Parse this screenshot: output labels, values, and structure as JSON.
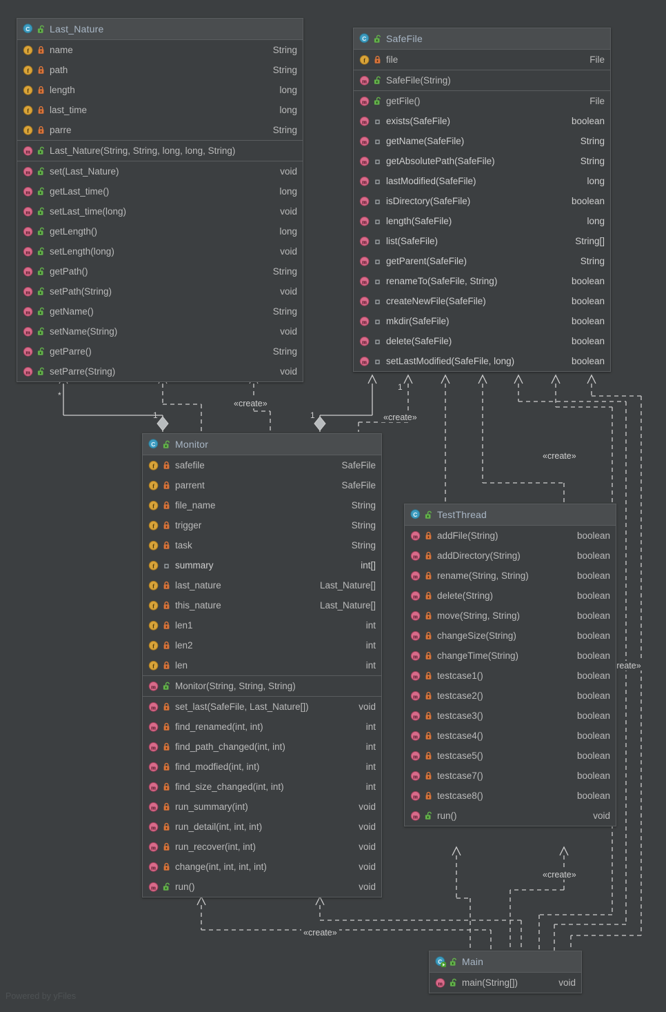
{
  "watermark": "Powered by yFiles",
  "diagram": {
    "kind": "uml-class-diagram",
    "background": "#3c3f41",
    "node_header_bg": "#4a4d4f",
    "border": "#5a5d5f",
    "text": "#bbbbbb",
    "edge": "#cfcfcf"
  },
  "classes": [
    {
      "id": "last_nature",
      "name": "Last_Nature",
      "icon": "class-icon",
      "visibility": "public",
      "fields": [
        {
          "name": "name",
          "type": "String",
          "icon": "field-icon",
          "visibility": "private",
          "static": false
        },
        {
          "name": "path",
          "type": "String",
          "icon": "field-icon",
          "visibility": "private",
          "static": false
        },
        {
          "name": "length",
          "type": "long",
          "icon": "field-icon",
          "visibility": "private",
          "static": false
        },
        {
          "name": "last_time",
          "type": "long",
          "icon": "field-icon",
          "visibility": "private",
          "static": false
        },
        {
          "name": "parre",
          "type": "String",
          "icon": "field-icon",
          "visibility": "private",
          "static": false
        }
      ],
      "constructors": [
        {
          "name": "Last_Nature(String, String, long, long, String)",
          "type": "",
          "icon": "method-icon",
          "visibility": "public",
          "static": false
        }
      ],
      "methods": [
        {
          "name": "set(Last_Nature)",
          "type": "void",
          "icon": "method-icon",
          "visibility": "public",
          "static": false
        },
        {
          "name": "getLast_time()",
          "type": "long",
          "icon": "method-icon",
          "visibility": "public",
          "static": false
        },
        {
          "name": "setLast_time(long)",
          "type": "void",
          "icon": "method-icon",
          "visibility": "public",
          "static": false
        },
        {
          "name": "getLength()",
          "type": "long",
          "icon": "method-icon",
          "visibility": "public",
          "static": false
        },
        {
          "name": "setLength(long)",
          "type": "void",
          "icon": "method-icon",
          "visibility": "public",
          "static": false
        },
        {
          "name": "getPath()",
          "type": "String",
          "icon": "method-icon",
          "visibility": "public",
          "static": false
        },
        {
          "name": "setPath(String)",
          "type": "void",
          "icon": "method-icon",
          "visibility": "public",
          "static": false
        },
        {
          "name": "getName()",
          "type": "String",
          "icon": "method-icon",
          "visibility": "public",
          "static": false
        },
        {
          "name": "setName(String)",
          "type": "void",
          "icon": "method-icon",
          "visibility": "public",
          "static": false
        },
        {
          "name": "getParre()",
          "type": "String",
          "icon": "method-icon",
          "visibility": "public",
          "static": false
        },
        {
          "name": "setParre(String)",
          "type": "void",
          "icon": "method-icon",
          "visibility": "public",
          "static": false
        }
      ]
    },
    {
      "id": "safefile",
      "name": "SafeFile",
      "icon": "class-icon",
      "visibility": "public",
      "fields": [
        {
          "name": "file",
          "type": "File",
          "icon": "field-icon",
          "visibility": "private",
          "static": false
        }
      ],
      "constructors": [
        {
          "name": "SafeFile(String)",
          "type": "",
          "icon": "method-icon",
          "visibility": "public",
          "static": false
        }
      ],
      "methods": [
        {
          "name": "getFile()",
          "type": "File",
          "icon": "method-icon",
          "visibility": "public",
          "static": false
        },
        {
          "name": "exists(SafeFile)",
          "type": "boolean",
          "icon": "method-icon",
          "visibility": "package",
          "static": true
        },
        {
          "name": "getName(SafeFile)",
          "type": "String",
          "icon": "method-icon",
          "visibility": "package",
          "static": true
        },
        {
          "name": "getAbsolutePath(SafeFile)",
          "type": "String",
          "icon": "method-icon",
          "visibility": "package",
          "static": true
        },
        {
          "name": "lastModified(SafeFile)",
          "type": "long",
          "icon": "method-icon",
          "visibility": "package",
          "static": true
        },
        {
          "name": "isDirectory(SafeFile)",
          "type": "boolean",
          "icon": "method-icon",
          "visibility": "package",
          "static": true
        },
        {
          "name": "length(SafeFile)",
          "type": "long",
          "icon": "method-icon",
          "visibility": "package",
          "static": true
        },
        {
          "name": "list(SafeFile)",
          "type": "String[]",
          "icon": "method-icon",
          "visibility": "package",
          "static": true
        },
        {
          "name": "getParent(SafeFile)",
          "type": "String",
          "icon": "method-icon",
          "visibility": "package",
          "static": true
        },
        {
          "name": "renameTo(SafeFile, String)",
          "type": "boolean",
          "icon": "method-icon",
          "visibility": "package",
          "static": true
        },
        {
          "name": "createNewFile(SafeFile)",
          "type": "boolean",
          "icon": "method-icon",
          "visibility": "package",
          "static": true
        },
        {
          "name": "mkdir(SafeFile)",
          "type": "boolean",
          "icon": "method-icon",
          "visibility": "package",
          "static": true
        },
        {
          "name": "delete(SafeFile)",
          "type": "boolean",
          "icon": "method-icon",
          "visibility": "package",
          "static": true
        },
        {
          "name": "setLastModified(SafeFile, long)",
          "type": "boolean",
          "icon": "method-icon",
          "visibility": "package",
          "static": true
        }
      ]
    },
    {
      "id": "monitor",
      "name": "Monitor",
      "icon": "class-icon",
      "visibility": "public",
      "fields": [
        {
          "name": "safefile",
          "type": "SafeFile",
          "icon": "field-icon",
          "visibility": "private",
          "static": false
        },
        {
          "name": "parrent",
          "type": "SafeFile",
          "icon": "field-icon",
          "visibility": "private",
          "static": false
        },
        {
          "name": "file_name",
          "type": "String",
          "icon": "field-icon",
          "visibility": "private",
          "static": false
        },
        {
          "name": "trigger",
          "type": "String",
          "icon": "field-icon",
          "visibility": "private",
          "static": false
        },
        {
          "name": "task",
          "type": "String",
          "icon": "field-icon",
          "visibility": "private",
          "static": false
        },
        {
          "name": "summary",
          "type": "int[]",
          "icon": "field-icon",
          "visibility": "package",
          "static": true
        },
        {
          "name": "last_nature",
          "type": "Last_Nature[]",
          "icon": "field-icon",
          "visibility": "private",
          "static": false
        },
        {
          "name": "this_nature",
          "type": "Last_Nature[]",
          "icon": "field-icon",
          "visibility": "private",
          "static": false
        },
        {
          "name": "len1",
          "type": "int",
          "icon": "field-icon",
          "visibility": "private",
          "static": false
        },
        {
          "name": "len2",
          "type": "int",
          "icon": "field-icon",
          "visibility": "private",
          "static": false
        },
        {
          "name": "len",
          "type": "int",
          "icon": "field-icon",
          "visibility": "private",
          "static": false
        }
      ],
      "constructors": [
        {
          "name": "Monitor(String, String, String)",
          "type": "",
          "icon": "method-icon",
          "visibility": "public",
          "static": false
        }
      ],
      "methods": [
        {
          "name": "set_last(SafeFile, Last_Nature[])",
          "type": "void",
          "icon": "method-icon",
          "visibility": "private",
          "static": false
        },
        {
          "name": "find_renamed(int, int)",
          "type": "int",
          "icon": "method-icon",
          "visibility": "private",
          "static": false
        },
        {
          "name": "find_path_changed(int, int)",
          "type": "int",
          "icon": "method-icon",
          "visibility": "private",
          "static": false
        },
        {
          "name": "find_modfied(int, int)",
          "type": "int",
          "icon": "method-icon",
          "visibility": "private",
          "static": false
        },
        {
          "name": "find_size_changed(int, int)",
          "type": "int",
          "icon": "method-icon",
          "visibility": "private",
          "static": false
        },
        {
          "name": "run_summary(int)",
          "type": "void",
          "icon": "method-icon",
          "visibility": "private",
          "static": false
        },
        {
          "name": "run_detail(int, int, int)",
          "type": "void",
          "icon": "method-icon",
          "visibility": "private",
          "static": false
        },
        {
          "name": "run_recover(int, int)",
          "type": "void",
          "icon": "method-icon",
          "visibility": "private",
          "static": false
        },
        {
          "name": "change(int, int, int, int)",
          "type": "void",
          "icon": "method-icon",
          "visibility": "private",
          "static": false
        },
        {
          "name": "run()",
          "type": "void",
          "icon": "method-icon",
          "visibility": "public",
          "static": false
        }
      ]
    },
    {
      "id": "testthread",
      "name": "TestThread",
      "icon": "class-icon",
      "visibility": "public",
      "fields": [],
      "constructors": [],
      "methods": [
        {
          "name": "addFile(String)",
          "type": "boolean",
          "icon": "method-icon",
          "visibility": "private",
          "static": false
        },
        {
          "name": "addDirectory(String)",
          "type": "boolean",
          "icon": "method-icon",
          "visibility": "private",
          "static": false
        },
        {
          "name": "rename(String, String)",
          "type": "boolean",
          "icon": "method-icon",
          "visibility": "private",
          "static": false
        },
        {
          "name": "delete(String)",
          "type": "boolean",
          "icon": "method-icon",
          "visibility": "private",
          "static": false
        },
        {
          "name": "move(String, String)",
          "type": "boolean",
          "icon": "method-icon",
          "visibility": "private",
          "static": false
        },
        {
          "name": "changeSize(String)",
          "type": "boolean",
          "icon": "method-icon",
          "visibility": "private",
          "static": false
        },
        {
          "name": "changeTime(String)",
          "type": "boolean",
          "icon": "method-icon",
          "visibility": "private",
          "static": false
        },
        {
          "name": "testcase1()",
          "type": "boolean",
          "icon": "method-icon",
          "visibility": "private",
          "static": false
        },
        {
          "name": "testcase2()",
          "type": "boolean",
          "icon": "method-icon",
          "visibility": "private",
          "static": false
        },
        {
          "name": "testcase3()",
          "type": "boolean",
          "icon": "method-icon",
          "visibility": "private",
          "static": false
        },
        {
          "name": "testcase4()",
          "type": "boolean",
          "icon": "method-icon",
          "visibility": "private",
          "static": false
        },
        {
          "name": "testcase5()",
          "type": "boolean",
          "icon": "method-icon",
          "visibility": "private",
          "static": false
        },
        {
          "name": "testcase7()",
          "type": "boolean",
          "icon": "method-icon",
          "visibility": "private",
          "static": false
        },
        {
          "name": "testcase8()",
          "type": "boolean",
          "icon": "method-icon",
          "visibility": "private",
          "static": false
        },
        {
          "name": "run()",
          "type": "void",
          "icon": "method-icon",
          "visibility": "public",
          "static": false
        }
      ]
    },
    {
      "id": "main",
      "name": "Main",
      "icon": "runnable-class-icon",
      "visibility": "public",
      "fields": [],
      "constructors": [],
      "methods": [
        {
          "name": "main(String[])",
          "type": "void",
          "icon": "method-icon",
          "visibility": "public",
          "static": false
        }
      ]
    }
  ],
  "edge_labels": [
    {
      "id": "create-1",
      "text": "«create»"
    },
    {
      "id": "create-2",
      "text": "«create»"
    },
    {
      "id": "create-3",
      "text": "«create»"
    },
    {
      "id": "create-4",
      "text": "«create»"
    },
    {
      "id": "create-5",
      "text": "«create»"
    },
    {
      "id": "create-6",
      "text": "«create»"
    }
  ],
  "multiplicities": [
    {
      "id": "mult-star",
      "text": "*"
    },
    {
      "id": "mult-one-a",
      "text": "1"
    },
    {
      "id": "mult-one-b",
      "text": "1"
    },
    {
      "id": "mult-one-c",
      "text": "1"
    }
  ]
}
